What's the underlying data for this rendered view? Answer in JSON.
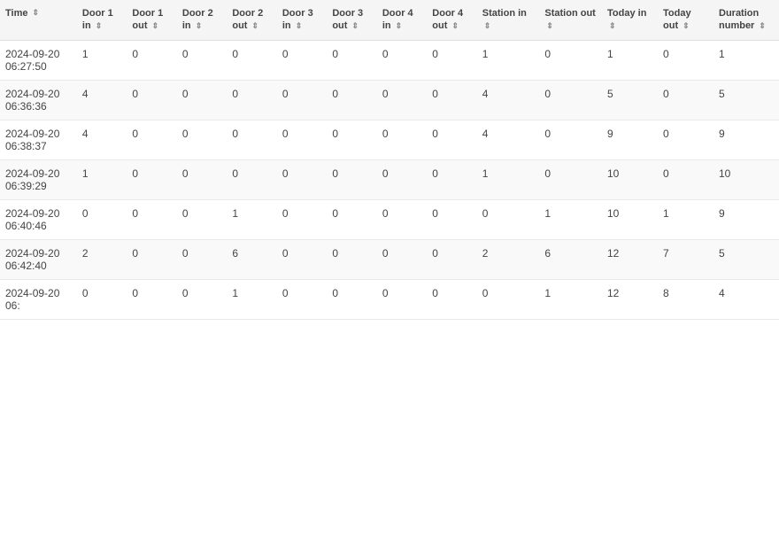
{
  "table": {
    "columns": [
      {
        "key": "time",
        "label": "Time",
        "sortable": true
      },
      {
        "key": "door1in",
        "label": "Door 1 in",
        "sortable": true
      },
      {
        "key": "door1out",
        "label": "Door 1 out",
        "sortable": true
      },
      {
        "key": "door2in",
        "label": "Door 2 in",
        "sortable": true
      },
      {
        "key": "door2out",
        "label": "Door 2 out",
        "sortable": true
      },
      {
        "key": "door3in",
        "label": "Door 3 in",
        "sortable": true
      },
      {
        "key": "door3out",
        "label": "Door 3 out",
        "sortable": true
      },
      {
        "key": "door4in",
        "label": "Door 4 in",
        "sortable": true
      },
      {
        "key": "door4out",
        "label": "Door 4 out",
        "sortable": true
      },
      {
        "key": "stationin",
        "label": "Station in",
        "sortable": true
      },
      {
        "key": "stationout",
        "label": "Station out",
        "sortable": true
      },
      {
        "key": "todayin",
        "label": "Today in",
        "sortable": true
      },
      {
        "key": "todayout",
        "label": "Today out",
        "sortable": true
      },
      {
        "key": "duration",
        "label": "Duration number",
        "sortable": true
      }
    ],
    "rows": [
      {
        "time": "2024-09-20 06:27:50",
        "door1in": "1",
        "door1out": "0",
        "door2in": "0",
        "door2out": "0",
        "door3in": "0",
        "door3out": "0",
        "door4in": "0",
        "door4out": "0",
        "stationin": "1",
        "stationout": "0",
        "todayin": "1",
        "todayout": "0",
        "duration": "1"
      },
      {
        "time": "2024-09-20 06:36:36",
        "door1in": "4",
        "door1out": "0",
        "door2in": "0",
        "door2out": "0",
        "door3in": "0",
        "door3out": "0",
        "door4in": "0",
        "door4out": "0",
        "stationin": "4",
        "stationout": "0",
        "todayin": "5",
        "todayout": "0",
        "duration": "5"
      },
      {
        "time": "2024-09-20 06:38:37",
        "door1in": "4",
        "door1out": "0",
        "door2in": "0",
        "door2out": "0",
        "door3in": "0",
        "door3out": "0",
        "door4in": "0",
        "door4out": "0",
        "stationin": "4",
        "stationout": "0",
        "todayin": "9",
        "todayout": "0",
        "duration": "9"
      },
      {
        "time": "2024-09-20 06:39:29",
        "door1in": "1",
        "door1out": "0",
        "door2in": "0",
        "door2out": "0",
        "door3in": "0",
        "door3out": "0",
        "door4in": "0",
        "door4out": "0",
        "stationin": "1",
        "stationout": "0",
        "todayin": "10",
        "todayout": "0",
        "duration": "10"
      },
      {
        "time": "2024-09-20 06:40:46",
        "door1in": "0",
        "door1out": "0",
        "door2in": "0",
        "door2out": "1",
        "door3in": "0",
        "door3out": "0",
        "door4in": "0",
        "door4out": "0",
        "stationin": "0",
        "stationout": "1",
        "todayin": "10",
        "todayout": "1",
        "duration": "9"
      },
      {
        "time": "2024-09-20 06:42:40",
        "door1in": "2",
        "door1out": "0",
        "door2in": "0",
        "door2out": "6",
        "door3in": "0",
        "door3out": "0",
        "door4in": "0",
        "door4out": "0",
        "stationin": "2",
        "stationout": "6",
        "todayin": "12",
        "todayout": "7",
        "duration": "5"
      },
      {
        "time": "2024-09-20 06:",
        "door1in": "0",
        "door1out": "0",
        "door2in": "0",
        "door2out": "1",
        "door3in": "0",
        "door3out": "0",
        "door4in": "0",
        "door4out": "0",
        "stationin": "0",
        "stationout": "1",
        "todayin": "12",
        "todayout": "8",
        "duration": "4"
      }
    ],
    "sort_icon": "⇕"
  }
}
